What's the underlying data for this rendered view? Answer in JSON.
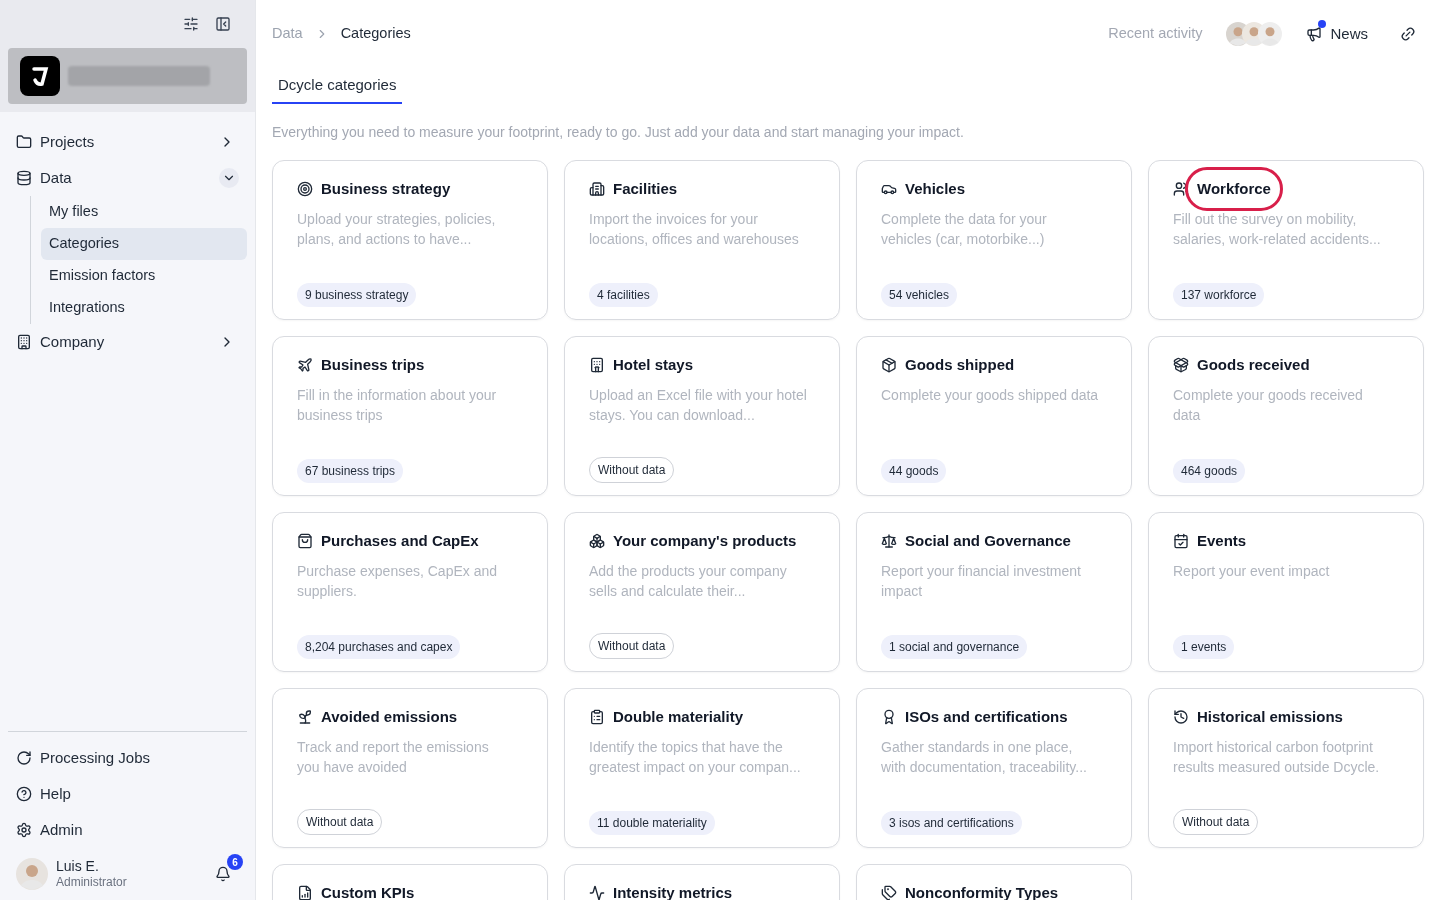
{
  "sidebar": {
    "nav": [
      {
        "label": "Projects",
        "expanded": false
      },
      {
        "label": "Data",
        "expanded": true,
        "children": [
          {
            "label": "My files",
            "selected": false
          },
          {
            "label": "Categories",
            "selected": true
          },
          {
            "label": "Emission factors",
            "selected": false
          },
          {
            "label": "Integrations",
            "selected": false
          }
        ]
      },
      {
        "label": "Company",
        "expanded": false
      }
    ],
    "footer": [
      "Processing Jobs",
      "Help",
      "Admin"
    ],
    "user": {
      "name": "Luis E.",
      "role": "Administrator",
      "notifications": "6"
    }
  },
  "header": {
    "breadcrumb": [
      "Data",
      "Categories"
    ],
    "recent_activity": "Recent activity",
    "news": {
      "label": "News",
      "unread": true
    }
  },
  "tabs": [
    {
      "label": "Dcycle categories",
      "selected": true
    }
  ],
  "intro": "Everything you need to measure your footprint, ready to go. Just add your data and start managing your impact.",
  "cards": [
    {
      "title": "Business strategy",
      "description": "Upload your strategies, policies, plans, and actions to have...",
      "badge": "9 business strategy",
      "has_data": true,
      "highlighted": false
    },
    {
      "title": "Facilities",
      "description": "Import the invoices for your locations, offices and warehouses",
      "badge": "4 facilities",
      "has_data": true,
      "highlighted": false
    },
    {
      "title": "Vehicles",
      "description": "Complete the data for your vehicles (car, motorbike...)",
      "badge": "54 vehicles",
      "has_data": true,
      "highlighted": false
    },
    {
      "title": "Workforce",
      "description": "Fill out the survey on mobility, salaries, work-related accidents...",
      "badge": "137 workforce",
      "has_data": true,
      "highlighted": true
    },
    {
      "title": "Business trips",
      "description": "Fill in the information about your business trips",
      "badge": "67 business trips",
      "has_data": true,
      "highlighted": false
    },
    {
      "title": "Hotel stays",
      "description": "Upload an Excel file with your hotel stays. You can download...",
      "badge": "Without data",
      "has_data": false,
      "highlighted": false
    },
    {
      "title": "Goods shipped",
      "description": "Complete your goods shipped data",
      "badge": "44 goods",
      "has_data": true,
      "highlighted": false
    },
    {
      "title": "Goods received",
      "description": "Complete your goods received data",
      "badge": "464 goods",
      "has_data": true,
      "highlighted": false
    },
    {
      "title": "Purchases and CapEx",
      "description": "Purchase expenses, CapEx and suppliers.",
      "badge": "8,204 purchases and capex",
      "has_data": true,
      "highlighted": false
    },
    {
      "title": "Your company's products",
      "description": "Add the products your company sells and calculate their...",
      "badge": "Without data",
      "has_data": false,
      "highlighted": false
    },
    {
      "title": "Social and Governance",
      "description": "Report your financial investment impact",
      "badge": "1 social and governance",
      "has_data": true,
      "highlighted": false
    },
    {
      "title": "Events",
      "description": "Report your event impact",
      "badge": "1 events",
      "has_data": true,
      "highlighted": false
    },
    {
      "title": "Avoided emissions",
      "description": "Track and report the emissions you have avoided",
      "badge": "Without data",
      "has_data": false,
      "highlighted": false
    },
    {
      "title": "Double materiality",
      "description": "Identify the topics that have the greatest impact on your compan...",
      "badge": "11 double materiality",
      "has_data": true,
      "highlighted": false
    },
    {
      "title": "ISOs and certifications",
      "description": "Gather standards in one place, with documentation, traceability...",
      "badge": "3 isos and certifications",
      "has_data": true,
      "highlighted": false
    },
    {
      "title": "Historical emissions",
      "description": "Import historical carbon footprint results measured outside Dcycle.",
      "badge": "Without data",
      "has_data": false,
      "highlighted": false
    },
    {
      "title": "Custom KPIs"
    },
    {
      "title": "Intensity metrics"
    },
    {
      "title": "Nonconformity Types"
    }
  ]
}
